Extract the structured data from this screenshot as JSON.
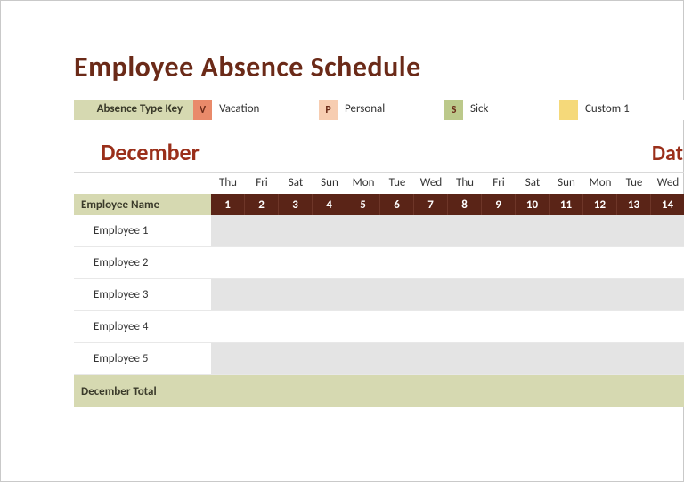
{
  "title": "Employee Absence Schedule",
  "legend": {
    "key_label": "Absence Type Key",
    "items": [
      {
        "code": "V",
        "label": "Vacation",
        "color": "#e98a6a"
      },
      {
        "code": "P",
        "label": "Personal",
        "color": "#f7cdb1"
      },
      {
        "code": "S",
        "label": "Sick",
        "color": "#bcc98b"
      },
      {
        "code": "",
        "label": "Custom 1",
        "color": "#f5d97a"
      }
    ]
  },
  "month": "December",
  "date_heading": "Dat",
  "days_of_week": [
    "Thu",
    "Fri",
    "Sat",
    "Sun",
    "Mon",
    "Tue",
    "Wed",
    "Thu",
    "Fri",
    "Sat",
    "Sun",
    "Mon",
    "Tue",
    "Wed"
  ],
  "day_numbers": [
    "1",
    "2",
    "3",
    "4",
    "5",
    "6",
    "7",
    "8",
    "9",
    "10",
    "11",
    "12",
    "13",
    "14"
  ],
  "employee_name_header": "Employee Name",
  "employees": [
    "Employee 1",
    "Employee 2",
    "Employee 3",
    "Employee 4",
    "Employee 5"
  ],
  "total_label": "December Total",
  "chart_data": {
    "type": "table",
    "title": "Employee Absence Schedule — December",
    "columns": [
      "Employee Name",
      "1",
      "2",
      "3",
      "4",
      "5",
      "6",
      "7",
      "8",
      "9",
      "10",
      "11",
      "12",
      "13",
      "14"
    ],
    "rows": [
      [
        "Employee 1",
        "",
        "",
        "",
        "",
        "",
        "",
        "",
        "",
        "",
        "",
        "",
        "",
        "",
        ""
      ],
      [
        "Employee 2",
        "",
        "",
        "",
        "",
        "",
        "",
        "",
        "",
        "",
        "",
        "",
        "",
        "",
        ""
      ],
      [
        "Employee 3",
        "",
        "",
        "",
        "",
        "",
        "",
        "",
        "",
        "",
        "",
        "",
        "",
        "",
        ""
      ],
      [
        "Employee 4",
        "",
        "",
        "",
        "",
        "",
        "",
        "",
        "",
        "",
        "",
        "",
        "",
        "",
        ""
      ],
      [
        "Employee 5",
        "",
        "",
        "",
        "",
        "",
        "",
        "",
        "",
        "",
        "",
        "",
        "",
        "",
        ""
      ]
    ],
    "legend": {
      "V": "Vacation",
      "P": "Personal",
      "S": "Sick",
      "": "Custom 1"
    }
  }
}
